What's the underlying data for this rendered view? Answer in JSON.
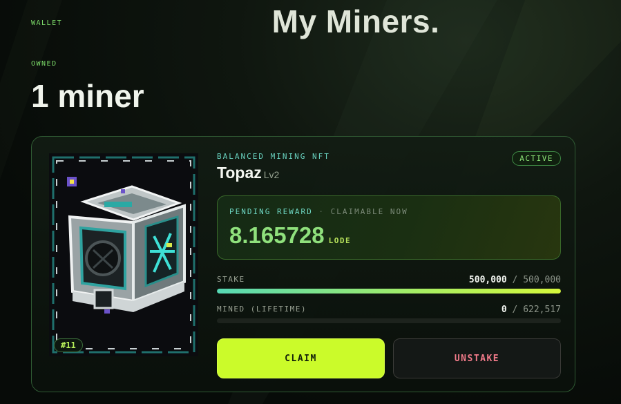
{
  "header": {
    "wallet_label": "WALLET",
    "title": "My Miners.",
    "owned_label": "OWNED",
    "owned_count": "1 miner"
  },
  "miner": {
    "type_label": "BALANCED MINING NFT",
    "name": "Topaz",
    "level": "Lv2",
    "status": "ACTIVE",
    "id": "#11",
    "reward": {
      "label": "PENDING REWARD",
      "separator": "·",
      "sublabel": "CLAIMABLE NOW",
      "value": "8.165728",
      "unit": "LODE"
    },
    "stake": {
      "label": "STAKE",
      "current": "500,000",
      "separator": "/",
      "max": "500,000",
      "fill_fraction": 1.0
    },
    "mined": {
      "label": "MINED (LIFETIME)",
      "current": "0",
      "separator": "/",
      "max": "622,517",
      "fill_fraction": 0.0
    },
    "claim_label": "CLAIM",
    "unstake_label": "UNSTAKE"
  },
  "colors": {
    "accent_lime": "#cbfb2a",
    "accent_teal": "#56d8b4",
    "status_green": "#8fe77a",
    "unstake_red": "#f27b8a"
  }
}
